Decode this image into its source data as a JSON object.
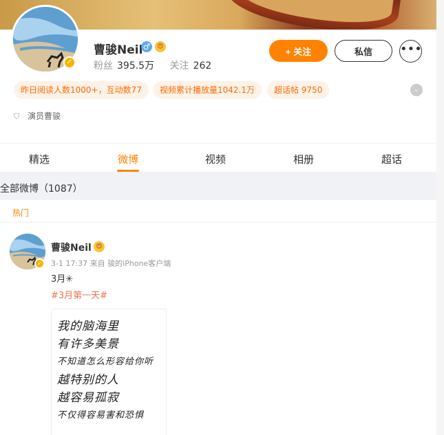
{
  "profile": {
    "name": "曹骏Neil",
    "gender_symbol": "♂",
    "emoji": "😍",
    "verified_symbol": "✓",
    "fans_label": "粉丝",
    "fans_value": "395.5万",
    "following_label": "关注",
    "following_value": "262",
    "identity": "演员曹骏",
    "identity_icon": "shield-icon"
  },
  "actions": {
    "follow_label": "+ 关注",
    "message_label": "私信",
    "more_label": "•••"
  },
  "tags": [
    "昨日阅读人数1000+，互动数77",
    "视频累计播放量1042.1万",
    "超话帖 9750"
  ],
  "expand_icon": "⌄",
  "tabs": [
    {
      "label": "精选"
    },
    {
      "label": "微博"
    },
    {
      "label": "视频"
    },
    {
      "label": "相册"
    },
    {
      "label": "超话"
    }
  ],
  "active_tab": "微博",
  "all_weibo_label": "全部微博（1087）",
  "post": {
    "hot_label": "热门",
    "author": "曹骏Neil",
    "emoji": "😍",
    "meta": "3-1 17:37  来自 骏的iPhone客户端",
    "text": "3月✳",
    "topic": "#3月第一天#",
    "handwriting": [
      "我的脑海里",
      "有许多美景",
      "不知道怎么形容给你听",
      "越特别的人",
      "越容易孤寂",
      "不仅得容易害和恐惧"
    ]
  },
  "colors": {
    "accent": "#ff8200",
    "topic": "#eb7350",
    "verified": "#f5b400"
  }
}
